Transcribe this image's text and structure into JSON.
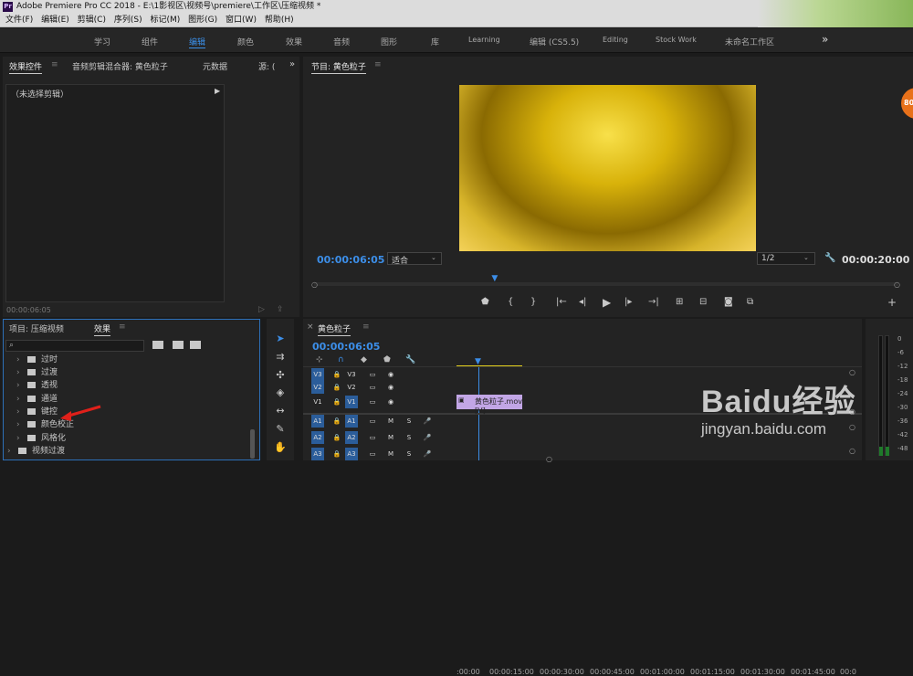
{
  "window": {
    "title": "Adobe Premiere Pro CC 2018 - E:\\1影视区\\视频号\\premiere\\工作区\\压缩视频 *",
    "app_icon": "Pr"
  },
  "menu": [
    "文件(F)",
    "编辑(E)",
    "剪辑(C)",
    "序列(S)",
    "标记(M)",
    "图形(G)",
    "窗口(W)",
    "帮助(H)"
  ],
  "workspaces": [
    "学习",
    "组件",
    "编辑",
    "颜色",
    "效果",
    "音频",
    "图形",
    "库",
    "Learning",
    "编辑 (CS5.5)",
    "Editing",
    "Stock Work",
    "未命名工作区"
  ],
  "workspace_more": "»",
  "source_panel": {
    "tabs": [
      "效果控件",
      "音频剪辑混合器: 黄色粒子",
      "元数据",
      "源: ("
    ],
    "no_clip": "（未选择剪辑）",
    "timecode": "00:00:06:05"
  },
  "program_monitor": {
    "title": "节目: 黄色粒子",
    "timecode_current": "00:00:06:05",
    "fit": "适合",
    "resolution": "1/2",
    "timecode_total": "00:00:20:00",
    "playhead_fraction": 0.31,
    "badge": "80"
  },
  "project_panel": {
    "tabs": [
      "项目: 压缩视频",
      "效果"
    ],
    "folders": [
      "过时",
      "过渡",
      "透视",
      "通道",
      "键控",
      "颜色校正",
      "风格化"
    ],
    "parent_folder": "视频过渡"
  },
  "timeline": {
    "sequence_name": "黄色粒子",
    "timecode": "00:00:06:05",
    "ruler": [
      ":00:00",
      "00:00:15:00",
      "00:00:30:00",
      "00:00:45:00",
      "00:01:00:00",
      "00:01:15:00",
      "00:01:30:00",
      "00:01:45:00",
      "00:0"
    ],
    "video_tracks": [
      "V3",
      "V2",
      "V1"
    ],
    "audio_tracks": [
      "A1",
      "A2",
      "A3"
    ],
    "clip_name": "黄色粒子.mov [V]",
    "track_labels": {
      "mute": "M",
      "solo": "S"
    }
  },
  "meter": {
    "labels": [
      "0",
      "-6",
      "-12",
      "-18",
      "-24",
      "-30",
      "-36",
      "-42",
      "-48",
      "-54"
    ]
  },
  "watermark": {
    "brand": "Baidu经验",
    "url": "jingyan.baidu.com"
  }
}
